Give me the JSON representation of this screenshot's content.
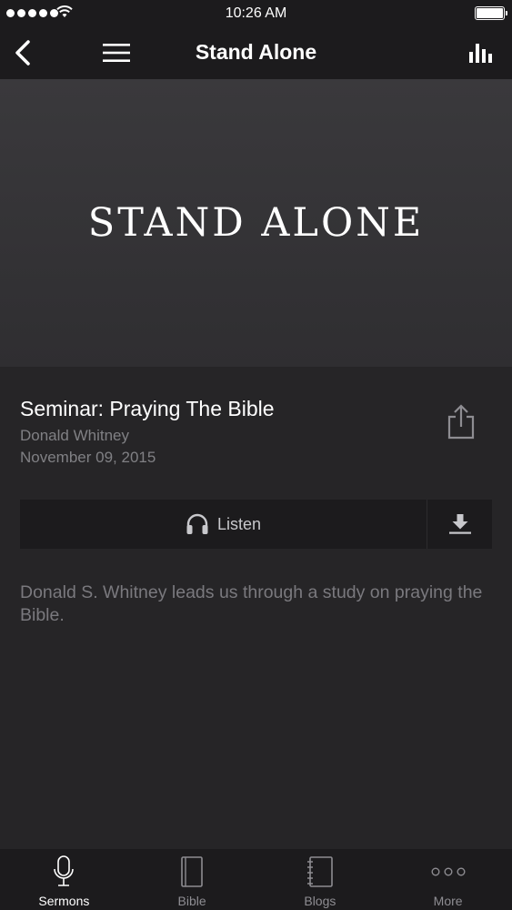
{
  "status_bar": {
    "time": "10:26 AM"
  },
  "header": {
    "title": "Stand Alone"
  },
  "hero": {
    "text": "STAND ALONE"
  },
  "sermon": {
    "title": "Seminar: Praying The Bible",
    "author": "Donald Whitney",
    "date": "November 09, 2015",
    "description": "Donald S. Whitney leads us through a study on praying the Bible."
  },
  "actions": {
    "listen_label": "Listen"
  },
  "tabs": [
    {
      "label": "Sermons",
      "icon": "microphone-icon",
      "active": true
    },
    {
      "label": "Bible",
      "icon": "book-icon",
      "active": false
    },
    {
      "label": "Blogs",
      "icon": "notebook-icon",
      "active": false
    },
    {
      "label": "More",
      "icon": "more-icon",
      "active": false
    }
  ]
}
